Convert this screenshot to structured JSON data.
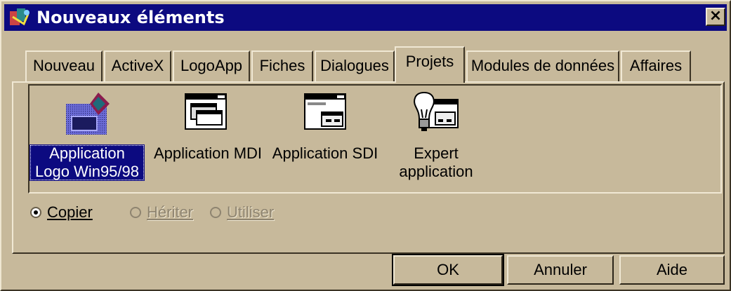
{
  "window": {
    "title": "Nouveaux éléments",
    "close_label": "×"
  },
  "tabs": [
    {
      "label": "Nouveau"
    },
    {
      "label": "ActiveX"
    },
    {
      "label": "LogoApp"
    },
    {
      "label": "Fiches"
    },
    {
      "label": "Dialogues"
    },
    {
      "label": "Projets",
      "active": true
    },
    {
      "label": "Modules de données"
    },
    {
      "label": "Affaires"
    }
  ],
  "items": [
    {
      "line1": "Application",
      "line2": "Logo Win95/98",
      "icon": "logo-app-icon",
      "selected": true
    },
    {
      "line1": "Application MDI",
      "line2": "",
      "icon": "mdi-window-icon"
    },
    {
      "line1": "Application SDI",
      "line2": "",
      "icon": "sdi-window-icon"
    },
    {
      "line1": "Expert",
      "line2": "application",
      "icon": "lightbulb-wizard-icon"
    }
  ],
  "options": {
    "copy": {
      "label": "Copier",
      "checked": true
    },
    "inherit": {
      "label": "Hériter",
      "disabled": true
    },
    "use": {
      "label": "Utiliser",
      "disabled": true
    }
  },
  "buttons": {
    "ok": "OK",
    "cancel": "Annuler",
    "help": "Aide"
  },
  "colors": {
    "face": "#c7b99b",
    "titlebar": "#0c0a80",
    "selection": "#0c0a80"
  }
}
